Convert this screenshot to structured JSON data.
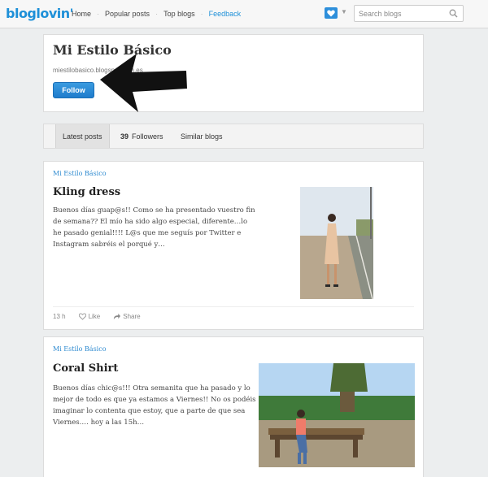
{
  "topbar": {
    "logo": "bloglovin'",
    "nav": [
      "Home",
      "Popular posts",
      "Top blogs",
      "Feedback"
    ],
    "search_placeholder": "Search blogs",
    "accent": "#1e90d8"
  },
  "blog": {
    "title": "Mi Estilo Básico",
    "url": "miestilobasico.blogspot.com.es",
    "follow_label": "Follow"
  },
  "tabs": {
    "latest": "Latest posts",
    "followers_count": "39",
    "followers_label": "Followers",
    "similar": "Similar blogs"
  },
  "posts": [
    {
      "blog": "Mi Estilo Básico",
      "title": "Kling dress",
      "excerpt": "Buenos días guap@s!! Como se ha presentado vuestro fin de semana?? El mío ha sido algo especial, diferente…lo he pasado genial!!!! L@s que me seguís por Twitter e Instagram sabréis el porqué y…",
      "time": "13 h",
      "like": "Like",
      "share": "Share"
    },
    {
      "blog": "Mi Estilo Básico",
      "title": "Coral Shirt",
      "excerpt": "Buenos días chic@s!!! Otra semanita que ha pasado y lo mejor de todo es que ya estamos a Viernes!! No os podéis imaginar lo contenta que estoy, que a parte de que sea Viernes.… hoy a las 15h…"
    }
  ]
}
